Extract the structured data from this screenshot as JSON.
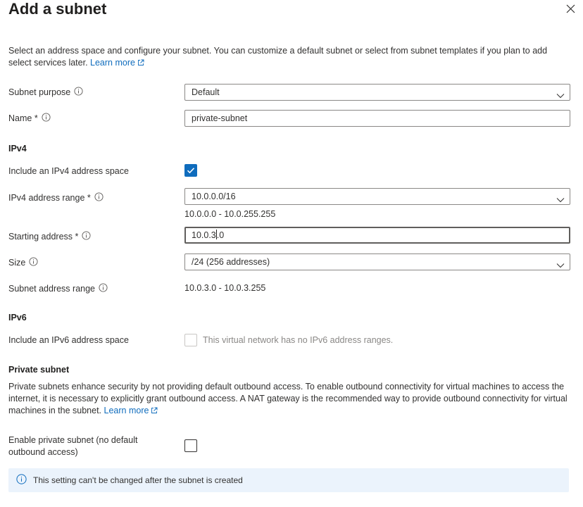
{
  "header": {
    "title": "Add a subnet",
    "close_icon": "close-icon"
  },
  "intro": {
    "text": "Select an address space and configure your subnet. You can customize a default subnet or select from subnet templates if you plan to add select services later.",
    "learn_more": "Learn more"
  },
  "form": {
    "subnet_purpose": {
      "label": "Subnet purpose",
      "value": "Default"
    },
    "name": {
      "label": "Name *",
      "value": "private-subnet"
    },
    "ipv4": {
      "heading": "IPv4",
      "include_label": "Include an IPv4 address space",
      "include_checked": true,
      "range_label": "IPv4 address range *",
      "range_value": "10.0.0.0/16",
      "range_hint": "10.0.0.0 - 10.0.255.255",
      "start_label": "Starting address *",
      "start_value_before_cursor": "10.0.3",
      "start_value_after_cursor": ".0",
      "size_label": "Size",
      "size_value": "/24 (256 addresses)",
      "subnet_range_label": "Subnet address range",
      "subnet_range_value": "10.0.3.0 - 10.0.3.255"
    },
    "ipv6": {
      "heading": "IPv6",
      "include_label": "Include an IPv6 address space",
      "include_checked": false,
      "disabled_text": "This virtual network has no IPv6 address ranges."
    },
    "private": {
      "heading": "Private subnet",
      "description": "Private subnets enhance security by not providing default outbound access. To enable outbound connectivity for virtual machines to access the internet, it is necessary to explicitly grant outbound access. A NAT gateway is the recommended way to provide outbound connectivity for virtual machines in the subnet.",
      "learn_more": "Learn more",
      "enable_label": "Enable private subnet (no default outbound access)",
      "enable_checked": false,
      "notice": "This setting can't be changed after the subnet is created"
    }
  },
  "colors": {
    "accent": "#0f6cbd",
    "notice_bg": "#ebf3fc",
    "border": "#8a8886"
  }
}
